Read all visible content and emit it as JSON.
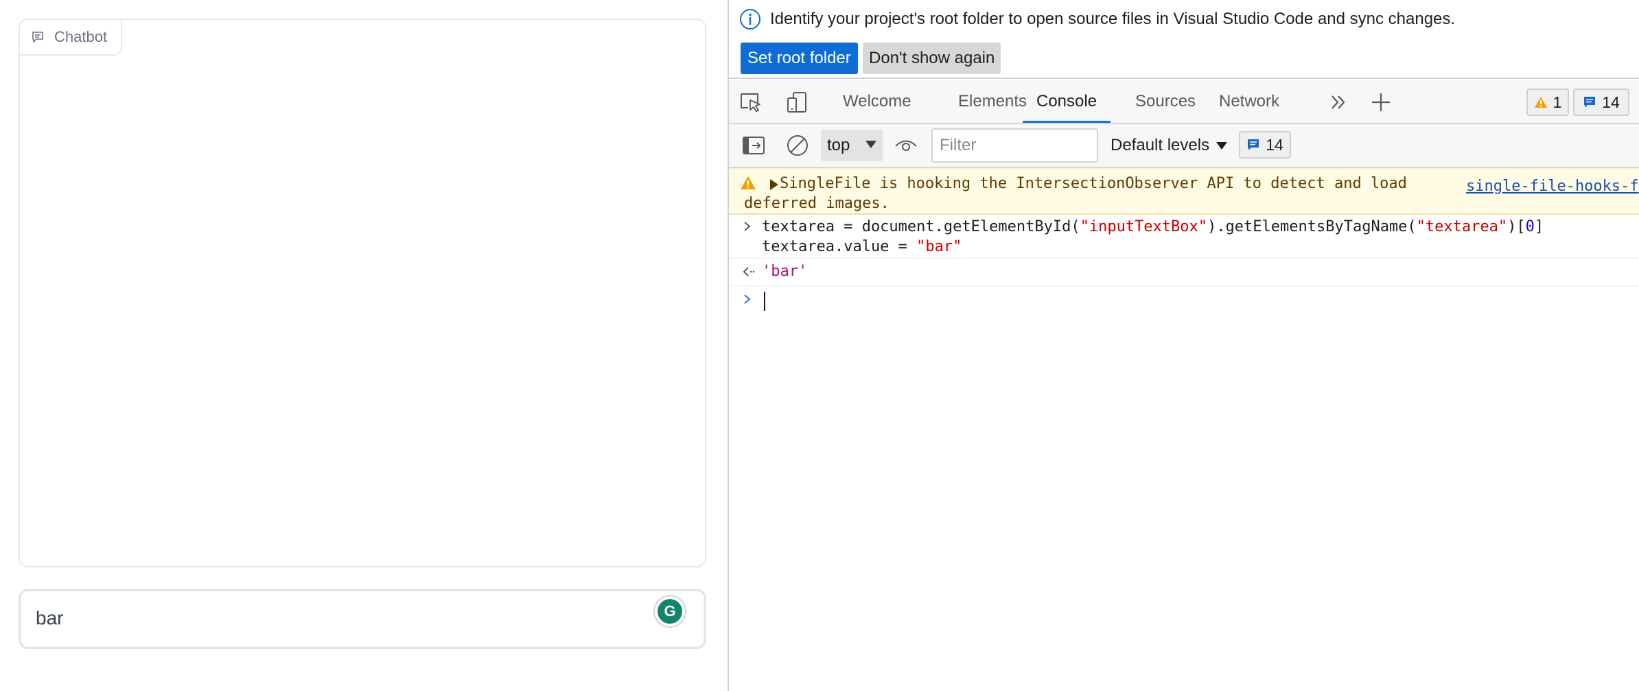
{
  "left": {
    "chatbot_label": "Chatbot",
    "input_value": "bar",
    "grammarly_letter": "G"
  },
  "infobar": {
    "message": "Identify your project's root folder to open source files in Visual Studio Code and sync changes.",
    "set_root_label": "Set root folder",
    "dont_show_label": "Don't show again"
  },
  "tabs": [
    {
      "label": "Welcome",
      "active": false
    },
    {
      "label": "Elements",
      "active": false
    },
    {
      "label": "Console",
      "active": true
    },
    {
      "label": "Sources",
      "active": false
    },
    {
      "label": "Network",
      "active": false
    }
  ],
  "badges": {
    "warnings": "1",
    "messages": "14"
  },
  "toolbar": {
    "context": "top",
    "filter_placeholder": "Filter",
    "levels_label": "Default levels",
    "messages": "14"
  },
  "console": {
    "warning_line1": "SingleFile is hooking the IntersectionObserver API to detect and load",
    "warning_line2": "deferred images.",
    "warning_source": "single-file-hooks-f",
    "cmd1_a": "textarea = document.getElementById(",
    "cmd1_str1": "\"inputTextBox\"",
    "cmd1_b": ").getElementsByTagName(",
    "cmd1_str2": "\"textarea\"",
    "cmd1_c": ")[",
    "cmd1_num": "0",
    "cmd1_d": "]",
    "cmd2_a": "textarea.value = ",
    "cmd2_str": "\"bar\"",
    "result": "'bar'"
  },
  "colors": {
    "accent": "#0f6cd4",
    "active_tab_underline": "#1a73e8",
    "warning_bg": "#fffbe5",
    "string_token": "#c80000",
    "result_token": "#a8136a"
  }
}
